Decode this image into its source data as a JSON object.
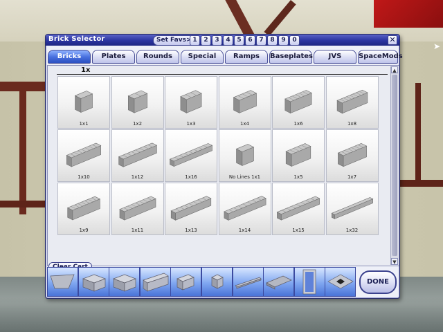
{
  "window": {
    "title": "Brick Selector",
    "set_favs_label": "Set Favs>",
    "fav_slots": [
      "1",
      "2",
      "3",
      "4",
      "5",
      "6",
      "7",
      "8",
      "9",
      "0"
    ],
    "close_glyph": "✕"
  },
  "tabs": [
    {
      "label": "Bricks",
      "active": true
    },
    {
      "label": "Plates",
      "active": false
    },
    {
      "label": "Rounds",
      "active": false
    },
    {
      "label": "Special",
      "active": false
    },
    {
      "label": "Ramps",
      "active": false
    },
    {
      "label": "Baseplates",
      "active": false
    },
    {
      "label": "JVS",
      "active": false
    },
    {
      "label": "SpaceMods",
      "active": false
    }
  ],
  "group": {
    "label": "1x"
  },
  "bricks": [
    {
      "label": "1x1",
      "kind": "block",
      "length": 1
    },
    {
      "label": "1x2",
      "kind": "block",
      "length": 2
    },
    {
      "label": "1x3",
      "kind": "block",
      "length": 3
    },
    {
      "label": "1x4",
      "kind": "block",
      "length": 4
    },
    {
      "label": "1x6",
      "kind": "block",
      "length": 6
    },
    {
      "label": "1x8",
      "kind": "block",
      "length": 8
    },
    {
      "label": "1x10",
      "kind": "block",
      "length": 10
    },
    {
      "label": "1x12",
      "kind": "block",
      "length": 12
    },
    {
      "label": "1x16",
      "kind": "block",
      "length": 16
    },
    {
      "label": "No Lines 1x1",
      "kind": "block",
      "length": 1
    },
    {
      "label": "1x5",
      "kind": "block",
      "length": 5
    },
    {
      "label": "1x7",
      "kind": "block",
      "length": 7
    },
    {
      "label": "1x9",
      "kind": "block",
      "length": 9
    },
    {
      "label": "1x11",
      "kind": "block",
      "length": 11
    },
    {
      "label": "1x13",
      "kind": "block",
      "length": 13
    },
    {
      "label": "1x14",
      "kind": "block",
      "length": 14
    },
    {
      "label": "1x15",
      "kind": "block",
      "length": 15
    },
    {
      "label": "1x32",
      "kind": "block",
      "length": 32
    }
  ],
  "cart": {
    "clear_label": "Clear Cart",
    "items": [
      "wedge-plate-icon",
      "brick-2x2-icon",
      "brick-2x2-icon",
      "brick-1x4-icon",
      "brick-1x2-icon",
      "brick-1x1-icon",
      "bar-icon",
      "flat-plate-icon",
      "window-frame-icon",
      "ramp-plate-icon"
    ]
  },
  "done_label": "DONE",
  "colors": {
    "accent": "#2b34a0",
    "tab_active": "#4a72e0",
    "cart_bg": "#7fa6f0"
  }
}
